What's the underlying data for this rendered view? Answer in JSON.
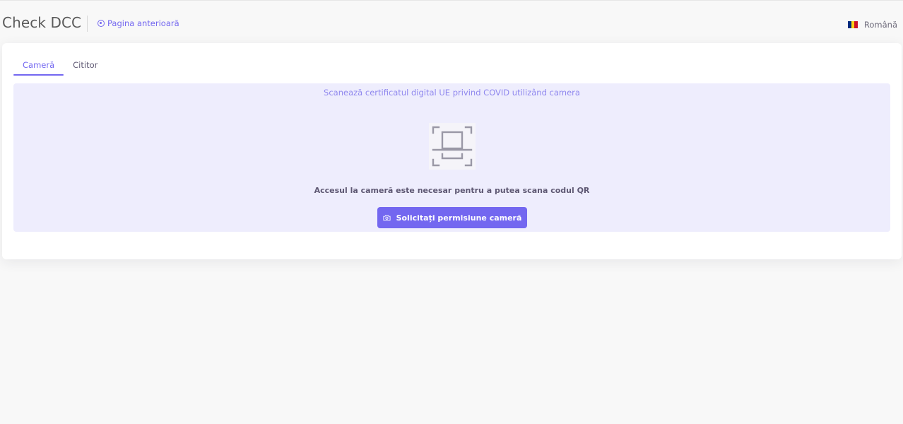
{
  "header": {
    "brand": "Check DCC",
    "back_link": "Pagina anterioară",
    "language": "Română",
    "flag_colors": [
      "#002B7F",
      "#FCD116",
      "#CE1126"
    ]
  },
  "tabs": [
    {
      "label": "Cameră",
      "active": true
    },
    {
      "label": "Cititor",
      "active": false
    }
  ],
  "scan_panel": {
    "title": "Scanează certificatul digital UE privind COVID utilizând camera",
    "icon": "qr-scan-icon",
    "requirement_text": "Accesul la cameră este necesar pentru a putea scana codul QR",
    "button_label": "Solicitați permisiune cameră",
    "button_icon": "camera-icon"
  },
  "colors": {
    "accent": "#7367f0",
    "panel_bg": "#eeedfd",
    "page_bg": "#f8f8f8"
  }
}
